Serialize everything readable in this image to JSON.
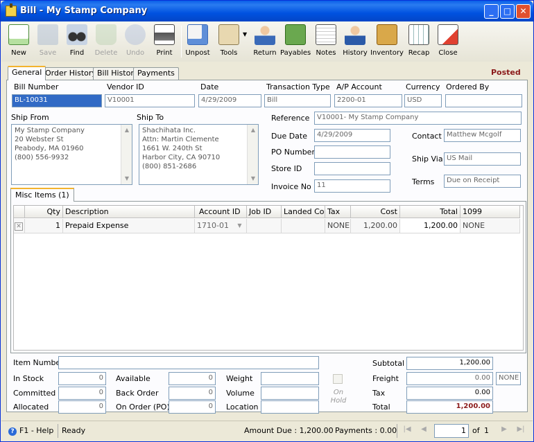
{
  "window": {
    "title": "Bill - My Stamp Company"
  },
  "toolbar": {
    "new": "New",
    "save": "Save",
    "find": "Find",
    "delete": "Delete",
    "undo": "Undo",
    "print": "Print",
    "unpost": "Unpost",
    "tools": "Tools",
    "return": "Return",
    "payables": "Payables",
    "notes": "Notes",
    "history": "History",
    "inventory": "Inventory",
    "recap": "Recap",
    "close": "Close"
  },
  "tabs": {
    "general": "General",
    "order_history": "Order History",
    "bill_history": "Bill History",
    "payments": "Payments"
  },
  "status_label": "Posted",
  "header": {
    "bill_number_label": "Bill Number",
    "bill_number": "BL-10031",
    "vendor_id_label": "Vendor ID",
    "vendor_id": "V10001",
    "date_label": "Date",
    "date": "4/29/2009",
    "transaction_type_label": "Transaction Type",
    "transaction_type": "Bill",
    "ap_account_label": "A/P Account",
    "ap_account": "2200-01",
    "currency_label": "Currency",
    "currency": "USD",
    "ordered_by_label": "Ordered By",
    "ordered_by": ""
  },
  "ship_from": {
    "label": "Ship From",
    "lines": [
      "My Stamp Company",
      "20 Webster St",
      "Peabody, MA 01960",
      "(800) 556-9932"
    ]
  },
  "ship_to": {
    "label": "Ship To",
    "lines": [
      "Shachihata Inc.",
      "Attn: Martin Clemente",
      "1661 W. 240th St",
      "Harbor City, CA 90710",
      "(800) 851-2686"
    ]
  },
  "details": {
    "reference_label": "Reference",
    "reference": "V10001- My Stamp Company",
    "due_date_label": "Due Date",
    "due_date": "4/29/2009",
    "po_number_label": "PO Number",
    "po_number": "",
    "store_id_label": "Store ID",
    "store_id": "",
    "invoice_no_label": "Invoice No",
    "invoice_no": "11",
    "contact_label": "Contact",
    "contact": "Matthew Mcgolf",
    "ship_via_label": "Ship Via",
    "ship_via": "US Mail",
    "terms_label": "Terms",
    "terms": "Due on Receipt"
  },
  "misc_tab": "Misc Items (1)",
  "grid": {
    "columns": [
      "Qty",
      "Description",
      "Account ID",
      "Job ID",
      "Landed Cos",
      "Tax",
      "Cost",
      "Total",
      "1099"
    ],
    "rows": [
      {
        "qty": "1",
        "description": "Prepaid Expense",
        "account_id": "1710-01",
        "job_id": "",
        "landed_cost": "",
        "tax": "NONE",
        "cost": "1,200.00",
        "total": "1,200.00",
        "c1099": "NONE"
      }
    ]
  },
  "inventory": {
    "item_number_label": "Item Number",
    "item_number": "",
    "in_stock_label": "In Stock",
    "in_stock": "0",
    "committed_label": "Committed",
    "committed": "0",
    "allocated_label": "Allocated",
    "allocated": "0",
    "available_label": "Available",
    "available": "0",
    "back_order_label": "Back Order",
    "back_order": "0",
    "on_order_label": "On Order (PO)",
    "on_order": "0",
    "weight_label": "Weight",
    "weight": "",
    "volume_label": "Volume",
    "volume": "",
    "location_label": "Location",
    "location": "",
    "on_hold_label": "On Hold"
  },
  "totals": {
    "subtotal_label": "Subtotal",
    "subtotal": "1,200.00",
    "freight_label": "Freight",
    "freight": "0.00",
    "freight_tax": "NONE",
    "tax_label": "Tax",
    "tax": "0.00",
    "total_label": "Total",
    "total": "1,200.00"
  },
  "statusbar": {
    "help": "F1 - Help",
    "state": "Ready",
    "amount_due": "Amount Due : 1,200.00",
    "payments": "Payments : 0.00",
    "page": "1",
    "of": "of",
    "pages": "1"
  },
  "colors": {
    "posted": "#8b1a1a",
    "title_bar": "#0a5fe8",
    "tab_accent": "#f3b32d"
  }
}
